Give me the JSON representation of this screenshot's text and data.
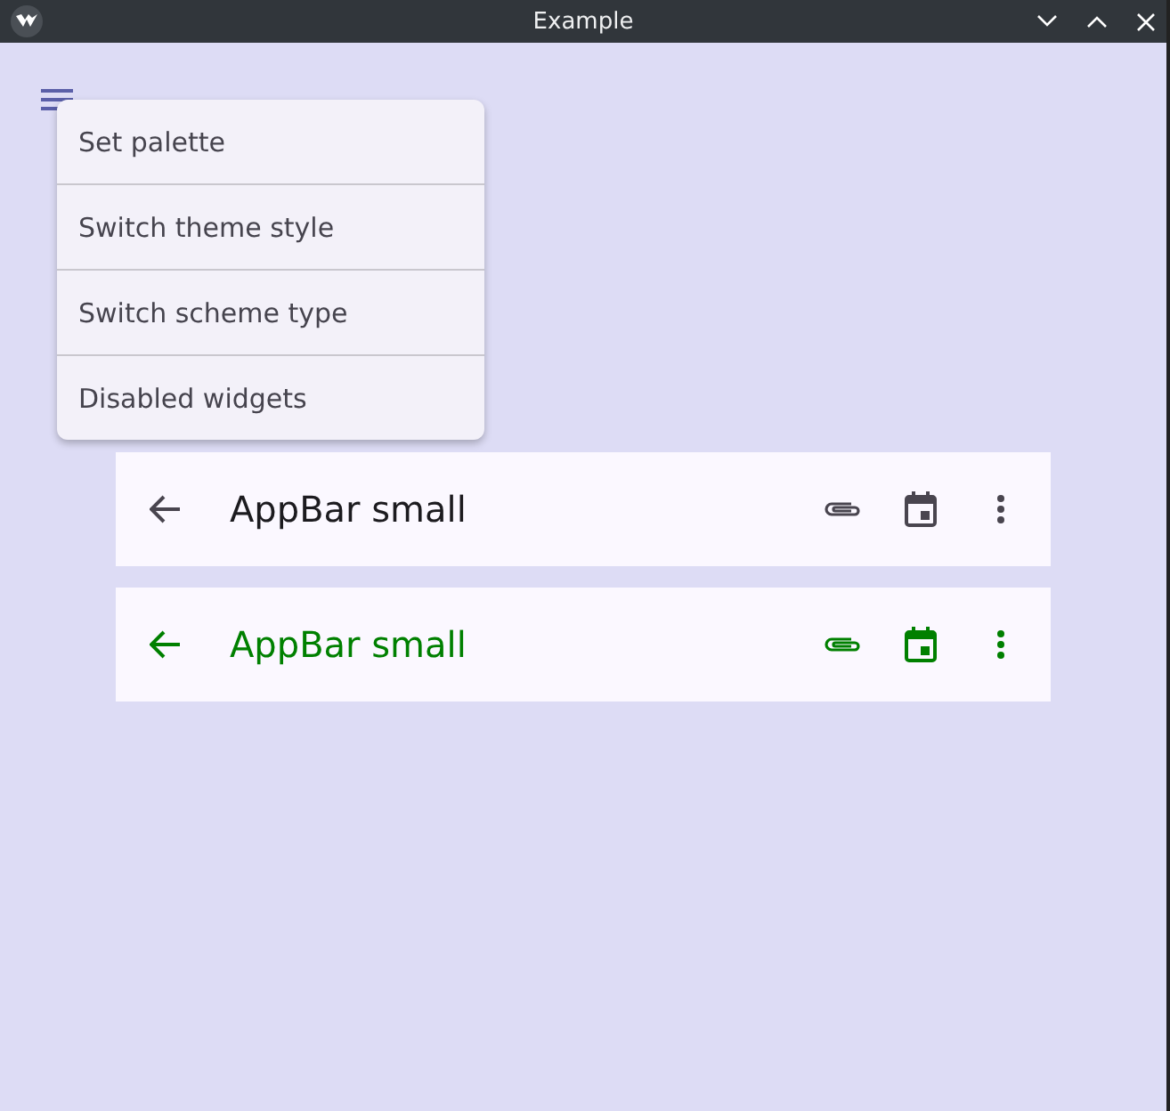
{
  "window": {
    "title": "Example"
  },
  "menu": {
    "items": [
      {
        "label": "Set palette"
      },
      {
        "label": "Switch theme style"
      },
      {
        "label": "Switch scheme type"
      },
      {
        "label": "Disabled widgets"
      }
    ]
  },
  "app_bars": [
    {
      "title": "AppBar small",
      "color": "#1c1b1f"
    },
    {
      "title": "AppBar small",
      "color": "#008000"
    }
  ]
}
